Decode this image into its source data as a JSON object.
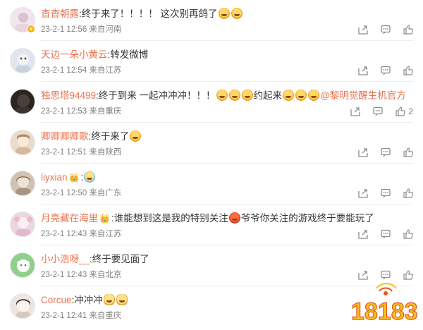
{
  "comments": [
    {
      "name": "杳杳朝露",
      "text": ":终于来了！！！！ 这次别再鸽了",
      "meta": "23-2-1 12:56 来自河南",
      "avatar_color": "#f2e6ee",
      "verified": true,
      "emojis_after": 2,
      "like_count": ""
    },
    {
      "name": "天边一朵小黄云",
      "text": ":转发微博",
      "meta": "23-2-1 12:54 来自江苏",
      "avatar_color": "#dfe6ef",
      "verified": false,
      "emojis_after": 0,
      "like_count": ""
    },
    {
      "name": "独思塔94499",
      "text": ":终于到来 一起冲冲冲！！！",
      "text2": "约起来",
      "mention": "@黎明觉醒生机官方",
      "meta": "23-2-1 12:53 来自重庆",
      "avatar_color": "#2a2520",
      "verified": false,
      "like_count": "2"
    },
    {
      "name": "卿卿卿卿歌",
      "text": ":终于来了",
      "meta": "23-2-1 12:51 来自陕西",
      "avatar_color": "#e9dccb",
      "verified": false,
      "emojis_after": 1,
      "like_count": ""
    },
    {
      "name": "liyxian",
      "text": ":",
      "meta": "23-2-1 12:50 来自广东",
      "avatar_color": "#cfc3b4",
      "verified": false,
      "crown": true,
      "emojis_after": 1,
      "like_count": ""
    },
    {
      "name": "月亮藏在海里",
      "text": ":谁能想到这是我的特别关注",
      "text2": "爷爷你关注的游戏终于要能玩了",
      "meta": "23-2-1 12:43 来自江苏",
      "avatar_color": "#ead7e0",
      "verified": false,
      "crown": true,
      "like_count": ""
    },
    {
      "name": "小小浩呀__",
      "text": ":终于要见面了",
      "meta": "23-2-1 12:43 来自北京",
      "avatar_color": "#8fd08a",
      "verified": false,
      "emojis_after": 0,
      "like_count": ""
    },
    {
      "name": "Corcue",
      "text": ":冲冲冲",
      "meta": "23-2-1 12:41 来自重庆",
      "avatar_color": "#efe6e2",
      "verified": false,
      "emojis_after": 2,
      "like_count": ""
    }
  ],
  "watermark": {
    "text": "18183",
    "colors": [
      "#f6c21c",
      "#e9541f"
    ]
  },
  "colors": {
    "name": "#eb7350",
    "meta": "#808080",
    "icon": "#8c8c8c"
  }
}
